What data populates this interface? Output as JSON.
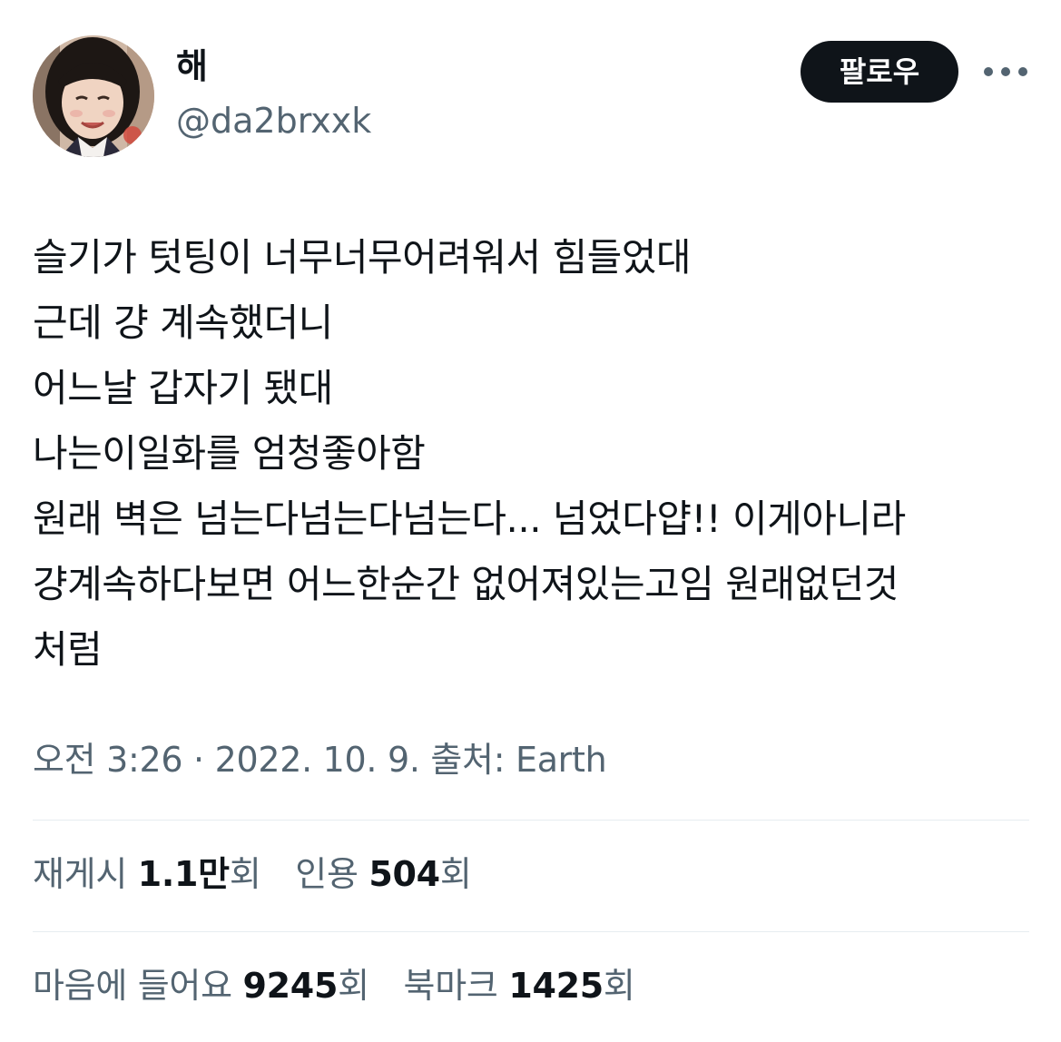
{
  "user": {
    "display_name": "해",
    "handle": "@da2brxxk",
    "avatar_icon": "profile-photo"
  },
  "actions": {
    "follow_label": "팔로우",
    "more_icon": "more-horizontal-icon"
  },
  "tweet": {
    "lines": [
      "슬기가 텃팅이 너무너무어려워서 힘들었대",
      "근데 걍 계속했더니",
      "어느날 갑자기 됐대",
      "나는이일화를 엄청좋아함",
      "원래 벽은 넘는다넘는다넘는다... 넘었다얍!! 이게아니라",
      "걍계속하다보면 어느한순간 없어져있는고임 원래없던것",
      "처럼"
    ]
  },
  "meta": {
    "text": "오전 3:26 · 2022. 10. 9. 출처: Earth"
  },
  "stats": {
    "retweets": {
      "label": "재게시",
      "value": "1.1만",
      "unit": "회"
    },
    "quotes": {
      "label": "인용",
      "value": "504",
      "unit": "회"
    },
    "likes": {
      "label": "마음에 들어요",
      "value": "9245",
      "unit": "회"
    },
    "bookmarks": {
      "label": "북마크",
      "value": "1425",
      "unit": "회"
    }
  },
  "colors": {
    "text_primary": "#0f1419",
    "text_secondary": "#536471",
    "divider": "#e6ecf0",
    "button_bg": "#0f1419"
  }
}
